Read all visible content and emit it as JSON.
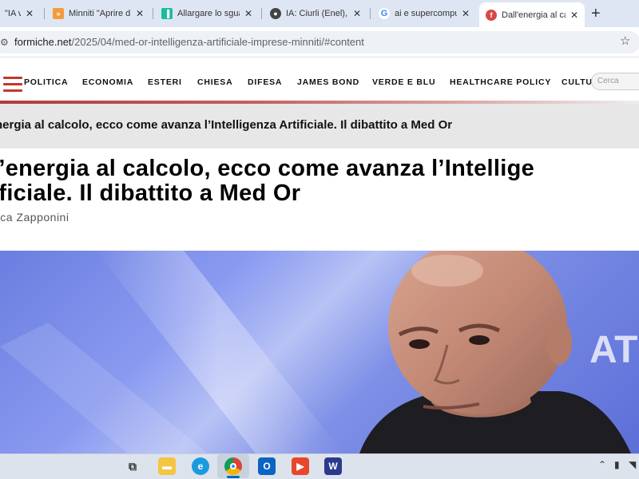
{
  "browser": {
    "tabs": [
      {
        "title": "\"IA vo",
        "favicon": "google-doc-icon",
        "color": "#2e8bd8"
      },
      {
        "title": "Minniti \"Aprire d",
        "favicon": "slides-icon",
        "color": "#f39c3c"
      },
      {
        "title": "Allargare lo sgua",
        "favicon": "site-icon",
        "color": "#1abc9c"
      },
      {
        "title": "IA: Ciurli (Enel), è",
        "favicon": "site-icon",
        "color": "#444444"
      },
      {
        "title": "ai e supercomput",
        "favicon": "google-icon",
        "color": "#4285f4"
      },
      {
        "title": "Dall'energia al ca",
        "favicon": "formiche-icon",
        "color": "#d94848"
      }
    ],
    "url_host": "formiche.net",
    "url_path": "/2025/04/med-or-intelligenza-artificiale-imprese-minniti/#content"
  },
  "site": {
    "nav": [
      "POLITICA",
      "ECONOMIA",
      "ESTERI",
      "CHIESA",
      "DIFESA",
      "JAMES BOND",
      "VERDE E BLU",
      "HEALTHCARE POLICY",
      "CULTURA"
    ],
    "search_placeholder": "Cerca"
  },
  "article": {
    "sticky_title": "nergia al calcolo, ecco come avanza l’Intelligenza Artificiale. Il dibattito a Med Or",
    "headline_line1": "l’energia al calcolo, ecco come avanza l’Intellige",
    "headline_line2": "ificiale. Il dibattito a Med Or",
    "author": "uca Zapponini"
  },
  "hero": {
    "background_text": "AT"
  },
  "colors": {
    "accent": "#c0392b",
    "sticky_bg": "#e7e7e7",
    "hero_blue": "#6a7ee0"
  }
}
